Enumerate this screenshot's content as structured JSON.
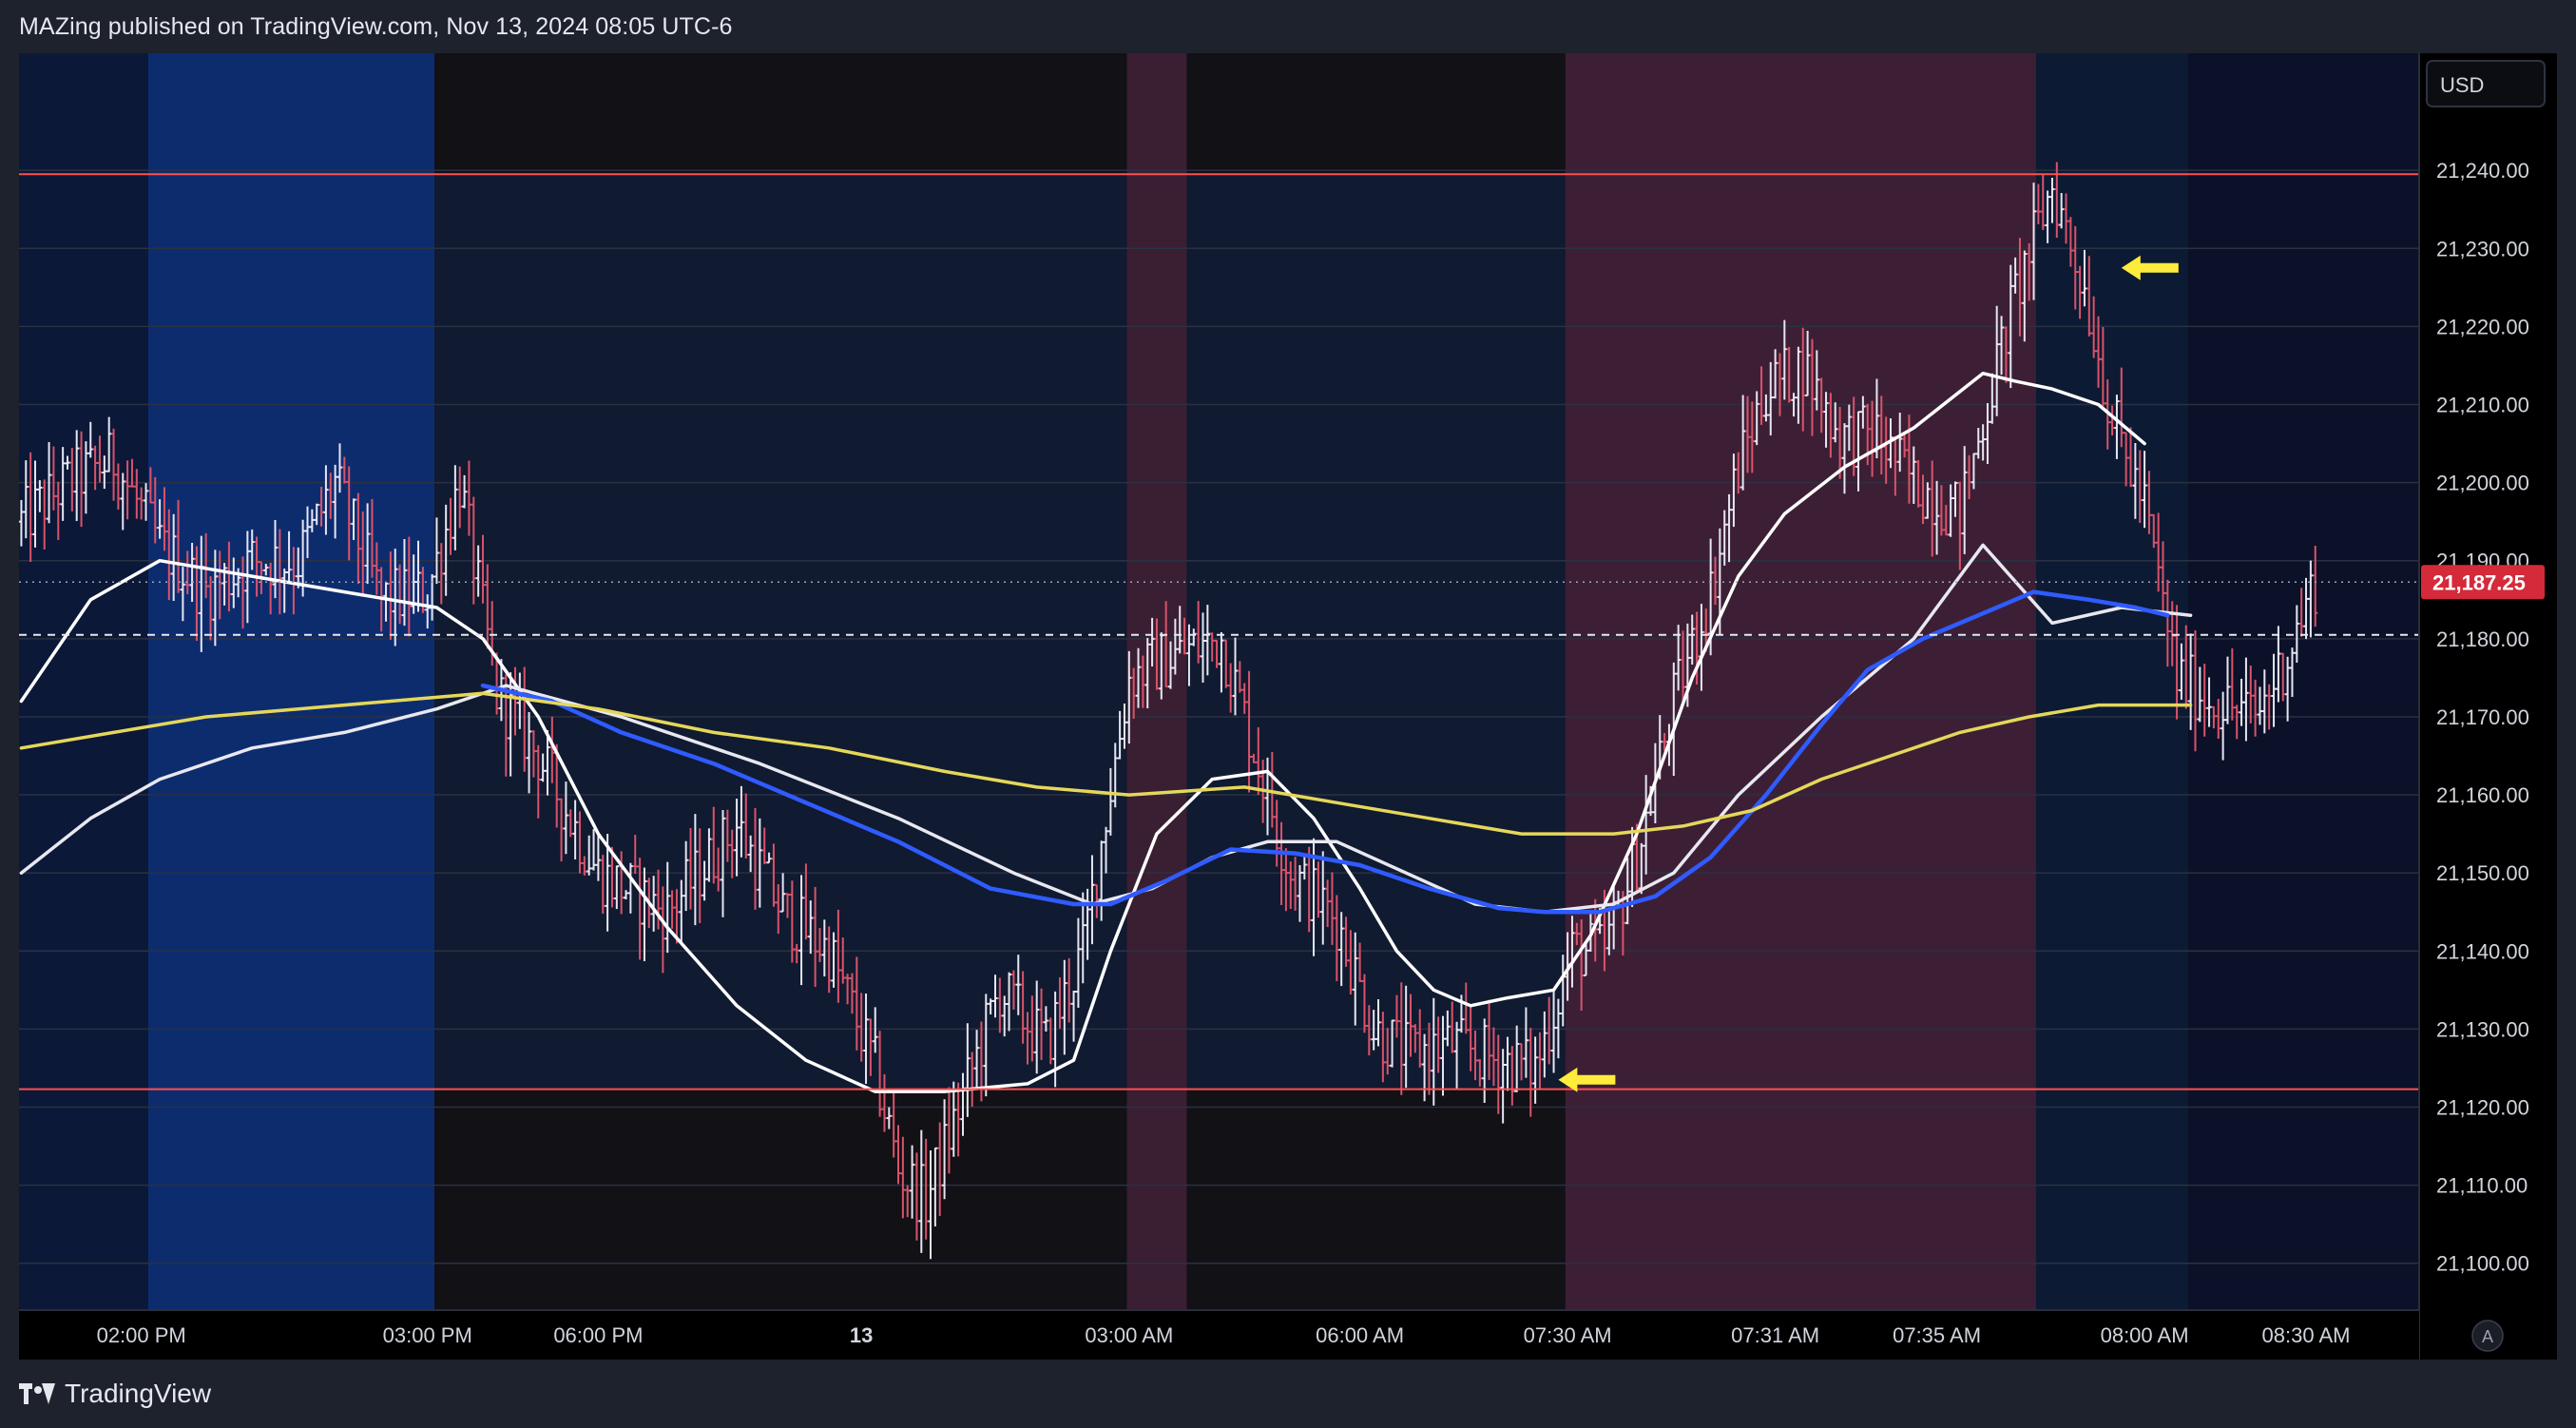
{
  "header": {
    "published_text": "MAZing published on TradingView.com, Nov 13, 2024 08:05 UTC-6"
  },
  "footer": {
    "brand": "TradingView"
  },
  "chart_data": {
    "type": "candlestick",
    "currency": "USD",
    "auto_scale_button": "A",
    "ylim": [
      21094,
      21255
    ],
    "y_ticks": [
      21100,
      21110,
      21120,
      21130,
      21140,
      21150,
      21160,
      21170,
      21180,
      21190,
      21200,
      21210,
      21220,
      21230,
      21240
    ],
    "y_tick_labels": [
      "21,100.00",
      "21,110.00",
      "21,120.00",
      "21,130.00",
      "21,140.00",
      "21,150.00",
      "21,160.00",
      "21,170.00",
      "21,180.00",
      "21,190.00",
      "21,200.00",
      "21,210.00",
      "21,220.00",
      "21,230.00",
      "21,240.00"
    ],
    "last_price": 21187.25,
    "last_price_label": "21,187.25",
    "dashed_level": 21180.5,
    "horizontal_levels": [
      21239.5,
      21122.3
    ],
    "x_labels": [
      "02:00 PM",
      "03:00 PM",
      "06:00 PM",
      "13",
      "03:00 AM",
      "06:00 AM",
      "07:30 AM",
      "07:31 AM",
      "07:35 AM",
      "08:00 AM",
      "08:30 AM"
    ],
    "x_label_bar_index": [
      26,
      88,
      125,
      182,
      240,
      290,
      335,
      380,
      415,
      460,
      495
    ],
    "total_bar_slots": 520,
    "data_bar_count": 470,
    "background_bands": [
      {
        "from": 0,
        "to": 28,
        "color": "#0b1838"
      },
      {
        "from": 28,
        "to": 90,
        "color": "#0d2c6e"
      },
      {
        "from": 90,
        "to": 240,
        "color": "#101a30"
      },
      {
        "from": 240,
        "to": 253,
        "color": "#3a1e32"
      },
      {
        "from": 253,
        "to": 335,
        "color": "#101a30"
      },
      {
        "from": 335,
        "to": 437,
        "color": "#3c1f35"
      },
      {
        "from": 437,
        "to": 470,
        "color": "#0d1a33"
      },
      {
        "from": 470,
        "to": 520,
        "color": "#0b1128"
      }
    ],
    "dark_strips_below_level": [
      {
        "from": 90,
        "to": 240
      },
      {
        "from": 253,
        "to": 335
      }
    ],
    "price_path": [
      [
        0,
        21195
      ],
      [
        10,
        21200
      ],
      [
        20,
        21203
      ],
      [
        30,
        21192
      ],
      [
        40,
        21186
      ],
      [
        50,
        21190
      ],
      [
        60,
        21190
      ],
      [
        68,
        21200
      ],
      [
        78,
        21185
      ],
      [
        88,
        21186
      ],
      [
        95,
        21200
      ],
      [
        103,
        21173
      ],
      [
        112,
        21165
      ],
      [
        125,
        21150
      ],
      [
        140,
        21145
      ],
      [
        155,
        21156
      ],
      [
        165,
        21145
      ],
      [
        175,
        21140
      ],
      [
        185,
        21125
      ],
      [
        190,
        21112
      ],
      [
        196,
        21108
      ],
      [
        202,
        21118
      ],
      [
        212,
        21135
      ],
      [
        222,
        21128
      ],
      [
        230,
        21140
      ],
      [
        240,
        21175
      ],
      [
        250,
        21178
      ],
      [
        260,
        21180
      ],
      [
        268,
        21164
      ],
      [
        275,
        21150
      ],
      [
        285,
        21144
      ],
      [
        293,
        21130
      ],
      [
        300,
        21127
      ],
      [
        310,
        21128
      ],
      [
        320,
        21126
      ],
      [
        328,
        21125
      ],
      [
        336,
        21140
      ],
      [
        343,
        21140
      ],
      [
        350,
        21152
      ],
      [
        358,
        21172
      ],
      [
        366,
        21186
      ],
      [
        372,
        21202
      ],
      [
        378,
        21212
      ],
      [
        386,
        21215
      ],
      [
        394,
        21206
      ],
      [
        402,
        21206
      ],
      [
        410,
        21200
      ],
      [
        420,
        21196
      ],
      [
        428,
        21215
      ],
      [
        432,
        21224
      ],
      [
        440,
        21238
      ],
      [
        447,
        21225
      ],
      [
        453,
        21208
      ],
      [
        460,
        21197
      ],
      [
        467,
        21175
      ],
      [
        475,
        21172
      ],
      [
        484,
        21170
      ],
      [
        491,
        21178
      ],
      [
        497,
        21187.25
      ]
    ],
    "moving_averages": [
      {
        "color": "#ffffff",
        "points": [
          [
            0,
            21172
          ],
          [
            15,
            21185
          ],
          [
            30,
            21190
          ],
          [
            50,
            21188
          ],
          [
            70,
            21186
          ],
          [
            90,
            21184
          ],
          [
            100,
            21180
          ],
          [
            112,
            21170
          ],
          [
            125,
            21155
          ],
          [
            140,
            21143
          ],
          [
            155,
            21133
          ],
          [
            170,
            21126
          ],
          [
            185,
            21122
          ],
          [
            200,
            21122
          ],
          [
            218,
            21123
          ],
          [
            228,
            21126
          ],
          [
            236,
            21140
          ],
          [
            246,
            21155
          ],
          [
            258,
            21162
          ],
          [
            270,
            21163
          ],
          [
            280,
            21157
          ],
          [
            290,
            21148
          ],
          [
            298,
            21140
          ],
          [
            306,
            21135
          ],
          [
            314,
            21133
          ],
          [
            322,
            21134
          ],
          [
            332,
            21135
          ],
          [
            340,
            21142
          ],
          [
            350,
            21155
          ],
          [
            362,
            21175
          ],
          [
            372,
            21188
          ],
          [
            382,
            21196
          ],
          [
            395,
            21202
          ],
          [
            410,
            21207
          ],
          [
            425,
            21214
          ],
          [
            432,
            21213
          ],
          [
            440,
            21212
          ],
          [
            450,
            21210
          ],
          [
            460,
            21205
          ]
        ]
      },
      {
        "color": "#e8e8f0",
        "points": [
          [
            0,
            21150
          ],
          [
            15,
            21157
          ],
          [
            30,
            21162
          ],
          [
            50,
            21166
          ],
          [
            70,
            21168
          ],
          [
            90,
            21171
          ],
          [
            105,
            21174
          ],
          [
            130,
            21170
          ],
          [
            160,
            21164
          ],
          [
            190,
            21157
          ],
          [
            215,
            21150
          ],
          [
            232,
            21146
          ],
          [
            245,
            21148
          ],
          [
            258,
            21152
          ],
          [
            270,
            21154
          ],
          [
            285,
            21154
          ],
          [
            300,
            21150
          ],
          [
            315,
            21146
          ],
          [
            330,
            21145
          ],
          [
            345,
            21146
          ],
          [
            358,
            21150
          ],
          [
            372,
            21160
          ],
          [
            390,
            21170
          ],
          [
            410,
            21180
          ],
          [
            425,
            21192
          ],
          [
            440,
            21182
          ],
          [
            455,
            21184
          ],
          [
            470,
            21183
          ]
        ]
      },
      {
        "color": "#2f5bff",
        "points": [
          [
            100,
            21174
          ],
          [
            115,
            21172
          ],
          [
            130,
            21168
          ],
          [
            150,
            21164
          ],
          [
            170,
            21159
          ],
          [
            190,
            21154
          ],
          [
            210,
            21148
          ],
          [
            228,
            21146
          ],
          [
            236,
            21146
          ],
          [
            248,
            21149
          ],
          [
            262,
            21153
          ],
          [
            276,
            21152.5
          ],
          [
            290,
            21151
          ],
          [
            305,
            21148
          ],
          [
            320,
            21145.5
          ],
          [
            330,
            21145
          ],
          [
            342,
            21145
          ],
          [
            354,
            21147
          ],
          [
            366,
            21152
          ],
          [
            378,
            21160
          ],
          [
            390,
            21169
          ],
          [
            400,
            21176
          ],
          [
            412,
            21180
          ],
          [
            424,
            21183
          ],
          [
            436,
            21186
          ],
          [
            448,
            21185
          ],
          [
            458,
            21184
          ],
          [
            465,
            21183
          ]
        ]
      },
      {
        "color": "#e5d75a",
        "points": [
          [
            0,
            21166
          ],
          [
            20,
            21168
          ],
          [
            40,
            21170
          ],
          [
            60,
            21171
          ],
          [
            80,
            21172
          ],
          [
            100,
            21173
          ],
          [
            125,
            21171
          ],
          [
            150,
            21168
          ],
          [
            175,
            21166
          ],
          [
            200,
            21163
          ],
          [
            220,
            21161
          ],
          [
            240,
            21160
          ],
          [
            265,
            21161
          ],
          [
            285,
            21159
          ],
          [
            305,
            21157
          ],
          [
            325,
            21155
          ],
          [
            345,
            21155
          ],
          [
            360,
            21156
          ],
          [
            375,
            21158
          ],
          [
            390,
            21162
          ],
          [
            405,
            21165
          ],
          [
            420,
            21168
          ],
          [
            435,
            21170
          ],
          [
            450,
            21171.5
          ],
          [
            460,
            21171.5
          ],
          [
            470,
            21171.5
          ]
        ]
      }
    ],
    "annotations": [
      {
        "type": "arrow-left",
        "bar_index": 455,
        "price": 21227.5,
        "color": "#ffeb3b"
      },
      {
        "type": "arrow-left",
        "bar_index": 333,
        "price": 21123.5,
        "color": "#ffeb3b"
      }
    ],
    "colors": {
      "up_bar": "#e6e6f2",
      "down_bar": "#d9536a",
      "level_line": "#ff4f4f",
      "price_label_bg": "#d42a3a",
      "axis_text": "#d1d4dc",
      "grid": "#2a3142",
      "dotted_line": "#a0a4b0",
      "dashed_line": "#e6e8ee"
    }
  }
}
